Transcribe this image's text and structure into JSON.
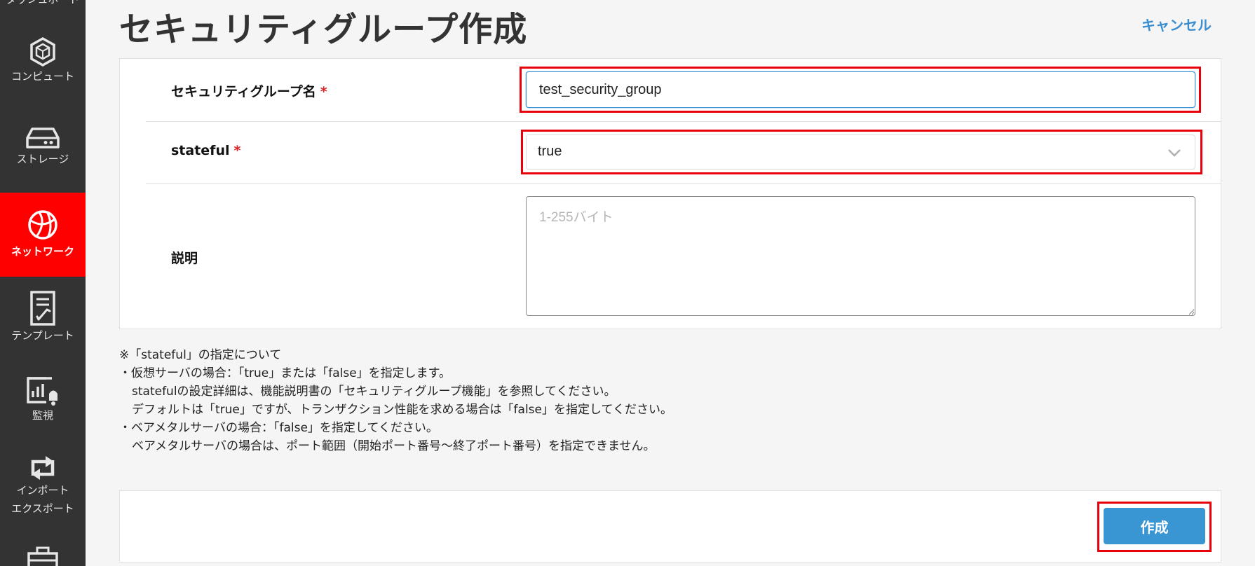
{
  "sidebar": {
    "items": [
      {
        "label": "ダッシュボード",
        "icon": "dashboard-icon"
      },
      {
        "label": "コンピュート",
        "icon": "cube-icon"
      },
      {
        "label": "ストレージ",
        "icon": "storage-drive-icon"
      },
      {
        "label": "ネットワーク",
        "icon": "globe-icon",
        "active": true
      },
      {
        "label": "テンプレート",
        "icon": "template-document-icon"
      },
      {
        "label": "監視",
        "icon": "monitoring-chart-bell-icon"
      },
      {
        "label": "インポート",
        "label2": "エクスポート",
        "icon": "import-export-arrows-icon"
      },
      {
        "label": "",
        "icon": "toolbox-icon"
      }
    ]
  },
  "header": {
    "title": "セキュリティグループ作成",
    "cancel_label": "キャンセル"
  },
  "form": {
    "name": {
      "label": "セキュリティグループ名",
      "required_mark": "*",
      "value": "test_security_group"
    },
    "stateful": {
      "label": "stateful",
      "required_mark": "*",
      "selected": "true"
    },
    "description": {
      "label": "説明",
      "placeholder": "1-255バイト",
      "value": ""
    }
  },
  "notes": [
    "※「stateful」の指定について",
    "・仮想サーバの場合：「true」または「false」を指定します。",
    "statefulの設定詳細は、機能説明書の「セキュリティグループ機能」を参照してください。",
    "デフォルトは「true」ですが、トランザクション性能を求める場合は「false」を指定してください。",
    "・ベアメタルサーバの場合：「false」を指定してください。",
    "ベアメタルサーバの場合は、ポート範囲（開始ポート番号～終了ポート番号）を指定できません。"
  ],
  "footer": {
    "create_label": "作成"
  },
  "colors": {
    "sidebar_bg": "#333333",
    "active_nav": "#ff0000",
    "accent_blue": "#3a95d3",
    "highlight_red": "#e8000b",
    "required_red": "#e0201e"
  }
}
